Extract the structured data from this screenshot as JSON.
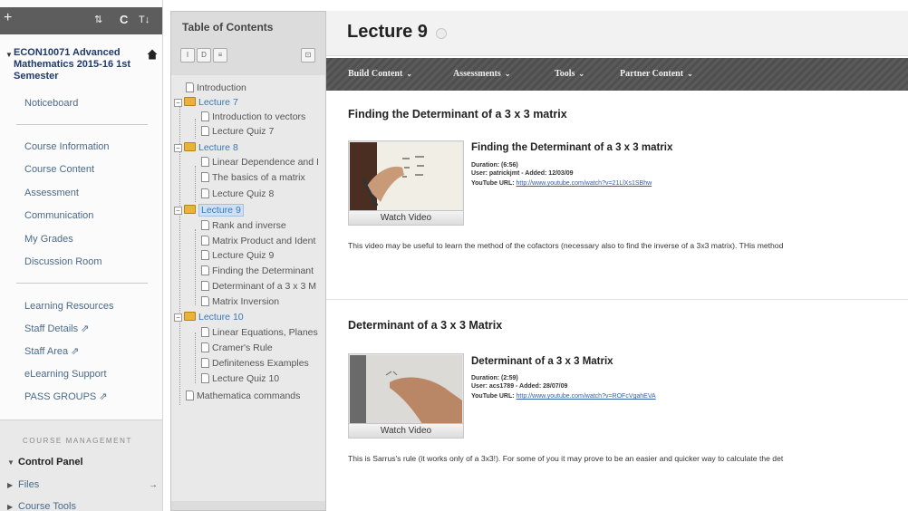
{
  "toolbar": {
    "plus": "+",
    "reorder": "⇅",
    "refresh": "C",
    "sort": "T↓"
  },
  "course": {
    "title": "ECON10071 Advanced Mathematics 2015-16 1st Semester"
  },
  "menu": {
    "noticeboard": "Noticeboard",
    "group1": [
      "Course Information",
      "Course Content",
      "Assessment",
      "Communication",
      "My Grades",
      "Discussion Room"
    ],
    "group2": [
      "Learning Resources",
      "Staff Details ⇗",
      "Staff Area ⇗",
      "eLearning Support",
      "PASS GROUPS ⇗"
    ]
  },
  "management": {
    "heading": "COURSE MANAGEMENT",
    "items": [
      "Control Panel",
      "Files",
      "Course Tools"
    ]
  },
  "toc": {
    "title": "Table of Contents",
    "buttons": [
      "I",
      "D",
      "≡",
      "⊡"
    ],
    "nodes": [
      "Introduction",
      "Lecture 7",
      "Introduction to vectors",
      "Lecture Quiz 7",
      "Lecture 8",
      "Linear Dependence and I",
      "The basics of a matrix",
      "Lecture Quiz 8",
      "Lecture 9",
      "Rank and inverse",
      "Matrix Product and Ident",
      "Lecture Quiz 9",
      "Finding the Determinant",
      "Determinant of a 3 x 3 M",
      "Matrix Inversion",
      "Lecture 10",
      "Linear Equations, Planes",
      "Cramer's Rule",
      "Definiteness Examples",
      "Lecture Quiz 10",
      "Mathematica commands"
    ]
  },
  "page": {
    "title": "Lecture 9"
  },
  "actions": [
    "Build Content",
    "Assessments",
    "Tools",
    "Partner Content"
  ],
  "items": [
    {
      "heading": "Finding the Determinant of a 3 x 3 matrix",
      "video_title": "Finding the Determinant of a 3 x 3 matrix",
      "duration": "Duration: (6:56)",
      "user": "User: patrickjmt - Added: 12/03/09",
      "url_label": "YouTube URL:",
      "url": "http://www.youtube.com/watch?v=21LlXs1SBhw",
      "watch": "Watch Video",
      "description": "This video may be useful to learn the method of the cofactors (necessary also to find the inverse of a 3x3 matrix). THis method"
    },
    {
      "heading": "Determinant of a 3 x 3 Matrix",
      "video_title": "Determinant of a 3 x 3 Matrix",
      "duration": "Duration: (2:59)",
      "user": "User: acs1789 - Added: 28/07/09",
      "url_label": "YouTube URL:",
      "url": "http://www.youtube.com/watch?v=ROFcVgahEVA",
      "watch": "Watch Video",
      "description": "This is Sarrus's rule (it works only of a 3x3!). For some of you it may prove to be an easier and quicker way to calculate the det"
    }
  ]
}
